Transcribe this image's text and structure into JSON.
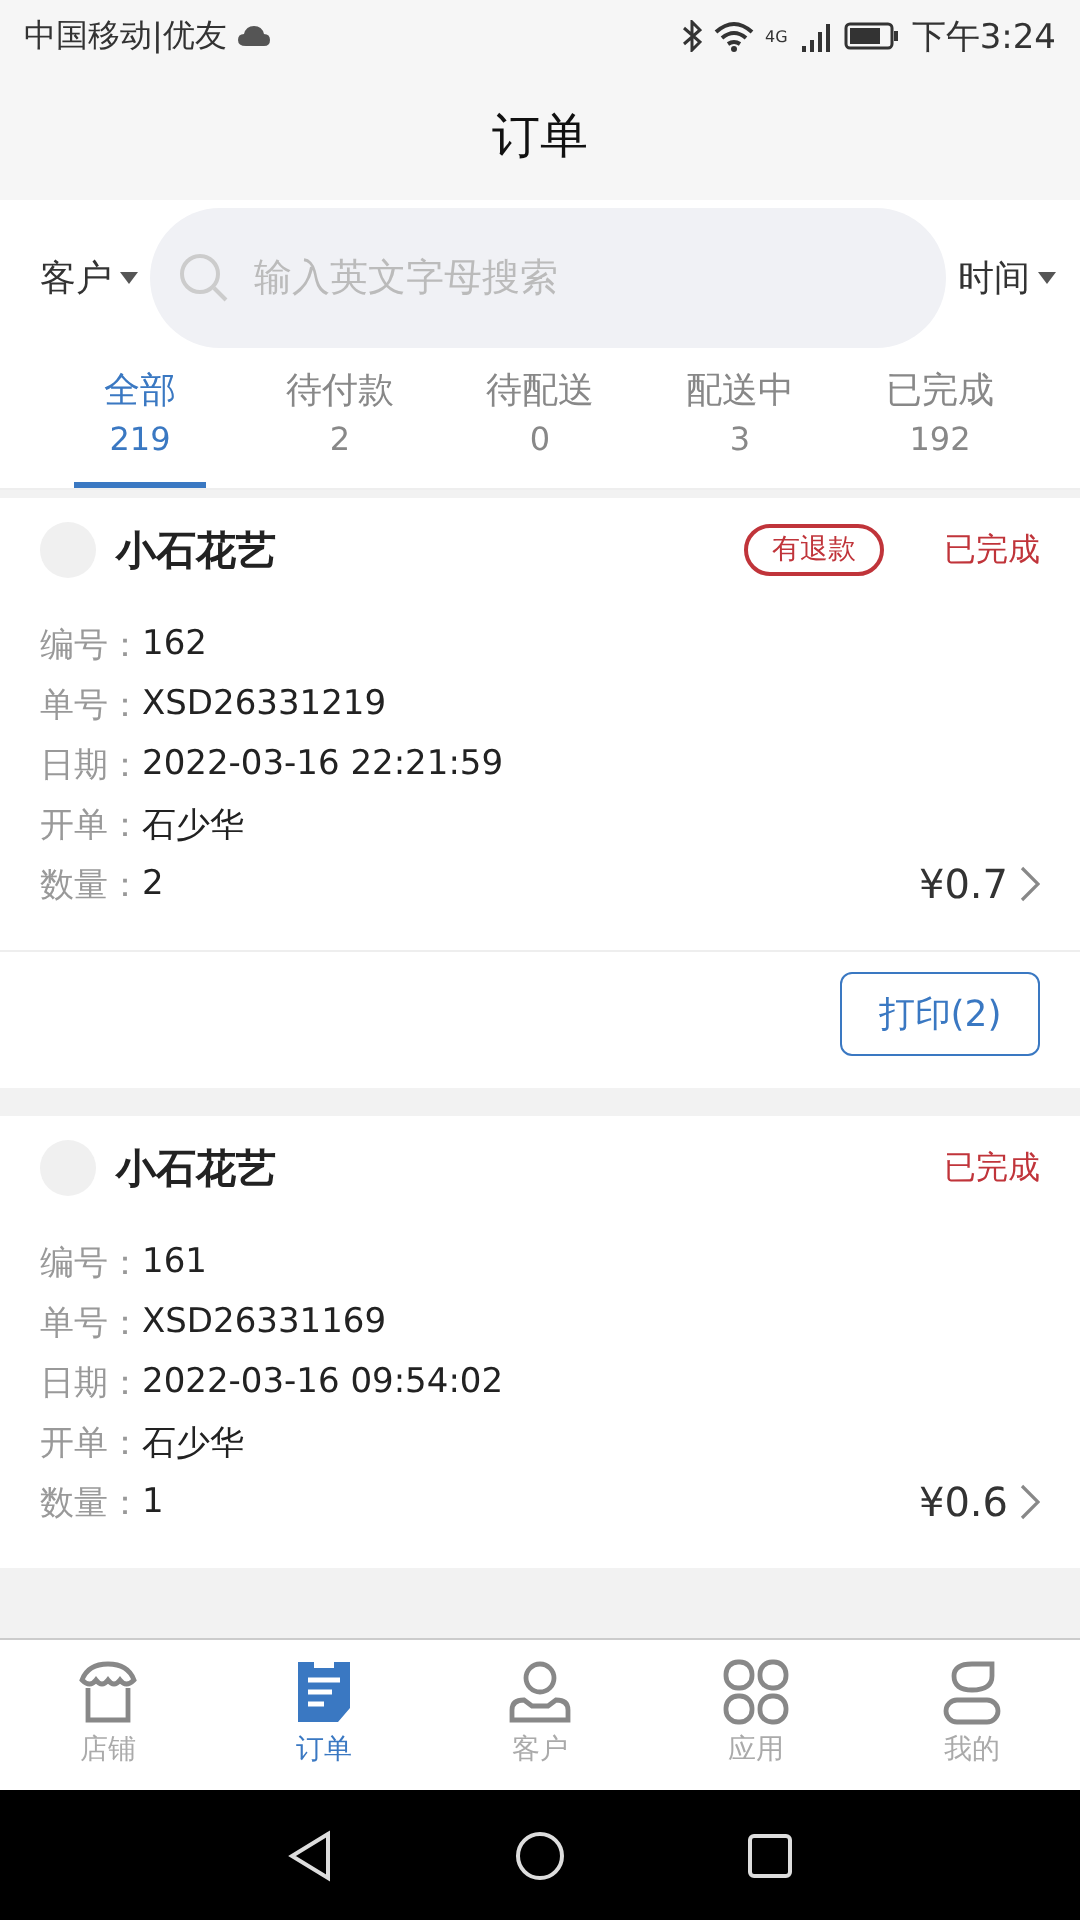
{
  "status_bar": {
    "carrier": "中国移动|优友",
    "network": "4G",
    "time": "下午3:24"
  },
  "title": "订单",
  "filter": {
    "customer": "客户",
    "search_placeholder": "输入英文字母搜索",
    "time": "时间"
  },
  "tabs": [
    {
      "label": "全部",
      "count": "219",
      "selected": true
    },
    {
      "label": "待付款",
      "count": "2",
      "selected": false
    },
    {
      "label": "待配送",
      "count": "0",
      "selected": false
    },
    {
      "label": "配送中",
      "count": "3",
      "selected": false
    },
    {
      "label": "已完成",
      "count": "192",
      "selected": false
    }
  ],
  "orders": [
    {
      "customer": "小石花艺",
      "refund_badge": "有退款",
      "status": "已完成",
      "fields": [
        {
          "label": "编号：",
          "value": "162"
        },
        {
          "label": "单号：",
          "value": "XSD26331219"
        },
        {
          "label": "日期：",
          "value": "2022-03-16 22:21:59"
        },
        {
          "label": "开单：",
          "value": "石少华"
        },
        {
          "label": "数量：",
          "value": "2"
        }
      ],
      "amount": "¥0.7",
      "print_button": "打印(2)"
    },
    {
      "customer": "小石花艺",
      "status": "已完成",
      "fields": [
        {
          "label": "编号：",
          "value": "161"
        },
        {
          "label": "单号：",
          "value": "XSD26331169"
        },
        {
          "label": "日期：",
          "value": "2022-03-16 09:54:02"
        },
        {
          "label": "开单：",
          "value": "石少华"
        },
        {
          "label": "数量：",
          "value": "1"
        }
      ],
      "amount": "¥0.6"
    }
  ],
  "bottom_nav": [
    {
      "kind": "store",
      "label": "店铺",
      "selected": false
    },
    {
      "kind": "orders",
      "label": "订单",
      "selected": true
    },
    {
      "kind": "customer",
      "label": "客户",
      "selected": false
    },
    {
      "kind": "apps",
      "label": "应用",
      "selected": false
    },
    {
      "kind": "me",
      "label": "我的",
      "selected": false
    }
  ]
}
